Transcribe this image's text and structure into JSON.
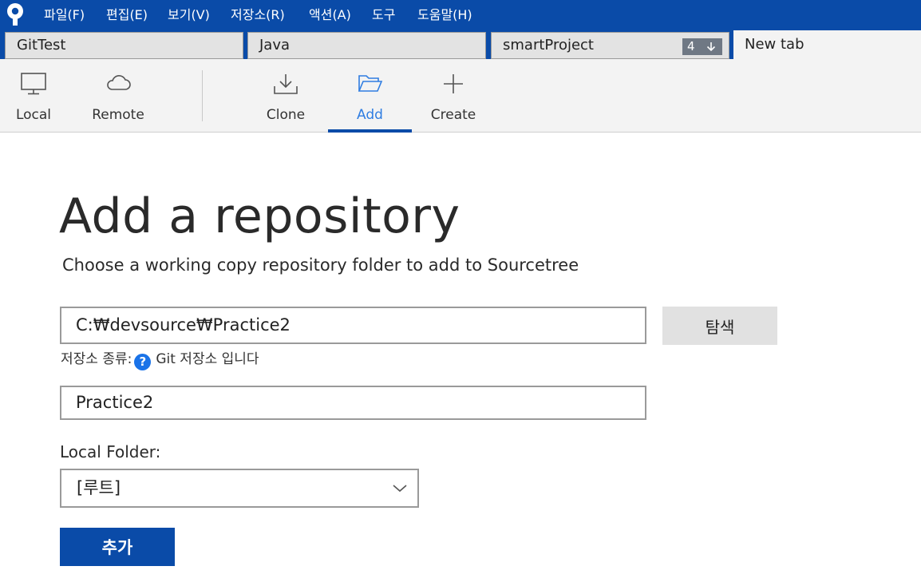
{
  "menu": [
    "파일(F)",
    "편집(E)",
    "보기(V)",
    "저장소(R)",
    "액션(A)",
    "도구",
    "도움말(H)"
  ],
  "tabs": [
    {
      "label": "GitTest"
    },
    {
      "label": "Java"
    },
    {
      "label": "smartProject",
      "badge": "4"
    },
    {
      "label": "New tab"
    }
  ],
  "toolbar": {
    "local": "Local",
    "remote": "Remote",
    "clone": "Clone",
    "add": "Add",
    "create": "Create",
    "active": "Add"
  },
  "main": {
    "title": "Add a repository",
    "subtitle": "Choose a working copy repository folder to add to Sourcetree",
    "path_value": "C:₩devsource₩Practice2",
    "browse_label": "탐색",
    "repo_type_label": "저장소 종류:",
    "repo_type_value": "Git 저장소 입니다",
    "name_value": "Practice2",
    "local_folder_label": "Local Folder:",
    "local_folder_value": "[루트]",
    "add_button": "추가"
  },
  "colors": {
    "brand": "#0a4ba8",
    "active_tab_label": "#2f7de1",
    "help_icon": "#1a73e8"
  },
  "icons": [
    "sourcetree-logo-icon",
    "monitor-icon",
    "cloud-icon",
    "download-icon",
    "folder-open-icon",
    "plus-icon",
    "arrow-down-icon",
    "help-icon",
    "chevron-down-icon"
  ]
}
